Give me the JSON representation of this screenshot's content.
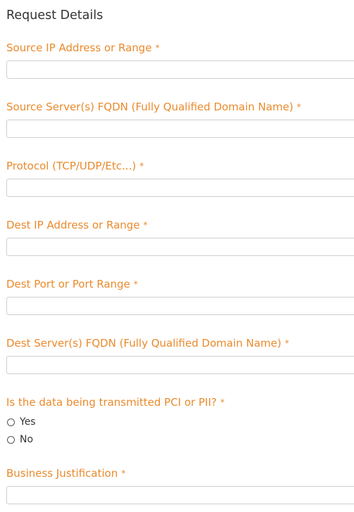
{
  "section": {
    "title": "Request Details"
  },
  "required_marker": "*",
  "fields": [
    {
      "label": "Source IP Address or Range",
      "value": ""
    },
    {
      "label": "Source Server(s) FQDN (Fully Qualified Domain Name)",
      "value": ""
    },
    {
      "label": "Protocol (TCP/UDP/Etc...)",
      "value": ""
    },
    {
      "label": "Dest IP Address or Range",
      "value": ""
    },
    {
      "label": "Dest Port or Port Range",
      "value": ""
    },
    {
      "label": "Dest Server(s) FQDN (Fully Qualified Domain Name)",
      "value": ""
    }
  ],
  "pci_question": {
    "label": "Is the data being transmitted PCI or PII?",
    "options": [
      "Yes",
      "No"
    ],
    "selected": null
  },
  "business_justification": {
    "label": "Business Justification",
    "value": ""
  },
  "colors": {
    "label": "#ea8a2c",
    "heading": "#333333",
    "input_border": "#cfcfcf"
  }
}
